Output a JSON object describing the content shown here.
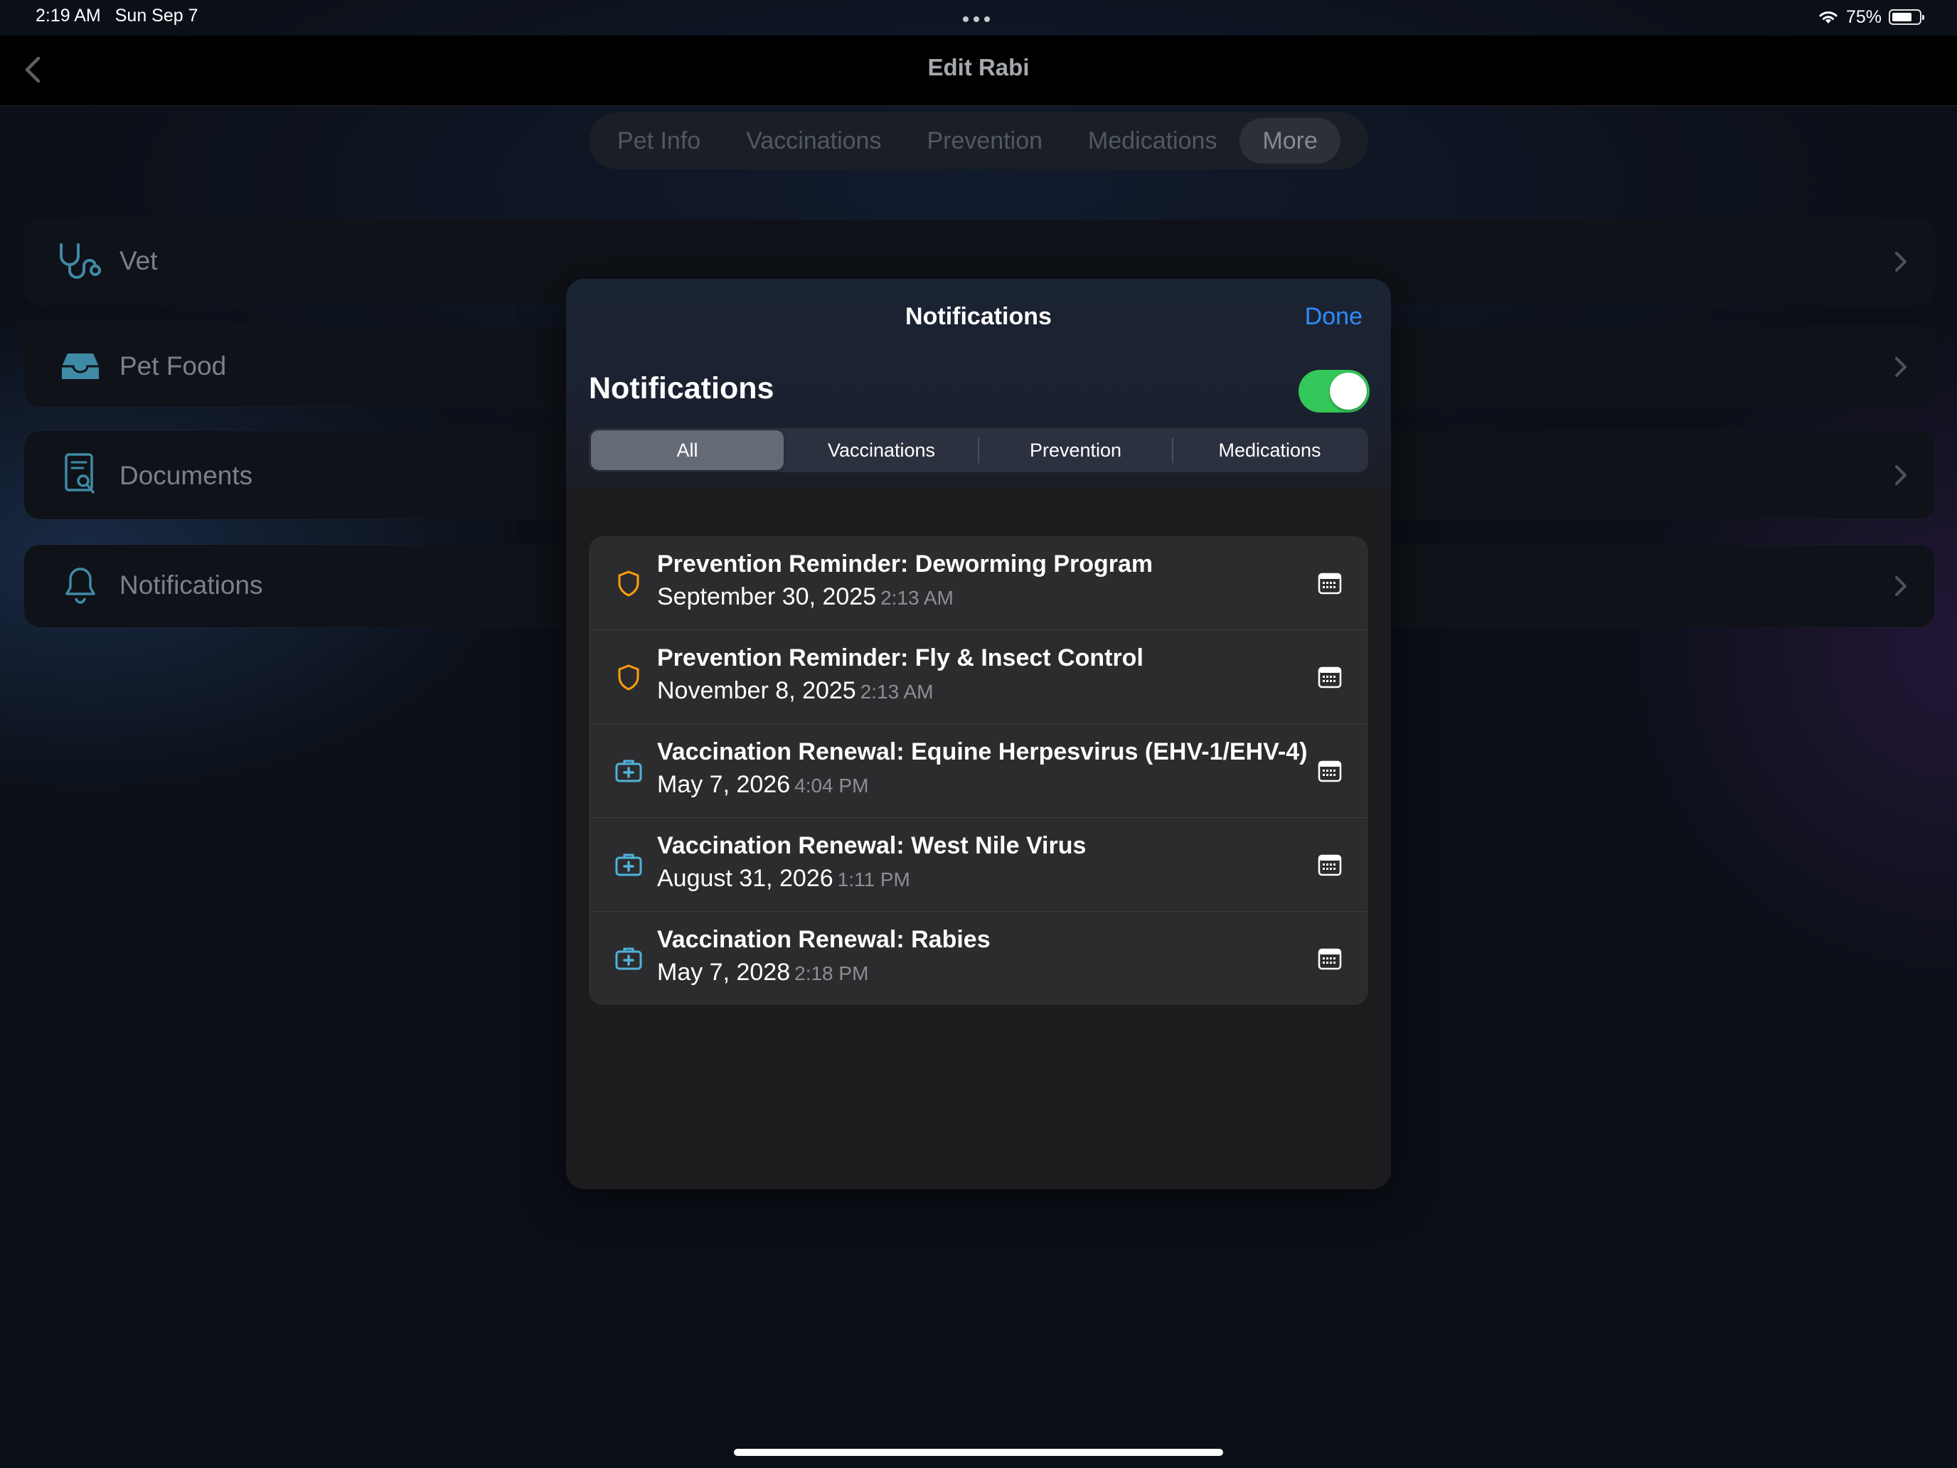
{
  "status_bar": {
    "time": "2:19 AM",
    "date": "Sun Sep 7",
    "battery_text": "75%",
    "battery_level": 0.75,
    "wifi_icon": "wifi-icon"
  },
  "nav": {
    "title": "Edit Rabi",
    "back_icon": "chevron-left-icon"
  },
  "top_tabs": [
    "Pet Info",
    "Vaccinations",
    "Prevention",
    "Medications",
    "More"
  ],
  "top_tabs_selected": "More",
  "bg_rows": [
    {
      "label": "Vet",
      "icon": "stethoscope-icon"
    },
    {
      "label": "Pet Food",
      "icon": "tray-icon"
    },
    {
      "label": "Documents",
      "icon": "document-search-icon"
    },
    {
      "label": "Notifications",
      "icon": "bell-icon"
    }
  ],
  "modal": {
    "title": "Notifications",
    "done_label": "Done",
    "section_title": "Notifications",
    "toggle_on": true,
    "filters": [
      "All",
      "Vaccinations",
      "Prevention",
      "Medications"
    ],
    "filter_selected": "All",
    "notifications": [
      {
        "type": "prevention",
        "icon": "shield-icon",
        "title": "Prevention Reminder: Deworming Program",
        "date": "September 30, 2025",
        "time": "2:13 AM"
      },
      {
        "type": "prevention",
        "icon": "shield-icon",
        "title": "Prevention Reminder: Fly & Insect Control",
        "date": "November 8, 2025",
        "time": "2:13 AM"
      },
      {
        "type": "vaccination",
        "icon": "medical-kit-icon",
        "title": "Vaccination Renewal: Equine Herpesvirus (EHV-1/EHV-4)",
        "date": "May 7, 2026",
        "time": "4:04 PM"
      },
      {
        "type": "vaccination",
        "icon": "medical-kit-icon",
        "title": "Vaccination Renewal: West Nile Virus",
        "date": "August 31, 2026",
        "time": "1:11 PM"
      },
      {
        "type": "vaccination",
        "icon": "medical-kit-icon",
        "title": "Vaccination Renewal: Rabies",
        "date": "May 7, 2028",
        "time": "2:18 PM"
      }
    ]
  },
  "colors": {
    "accent_blue": "#2f8cff",
    "toggle_green": "#34c759",
    "prevention_orange": "#ff9f0a",
    "vaccination_teal": "#4fb3d9",
    "dim_icon_teal": "#3f8aa5"
  }
}
